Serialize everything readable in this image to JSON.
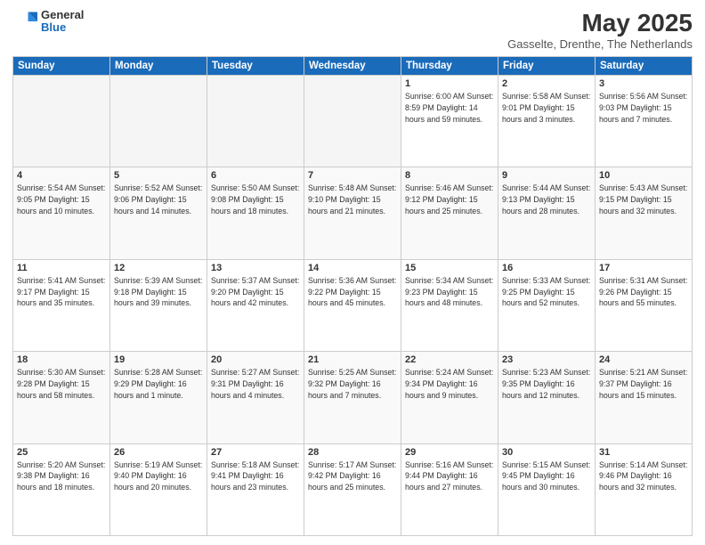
{
  "header": {
    "logo_general": "General",
    "logo_blue": "Blue",
    "month_title": "May 2025",
    "location": "Gasselte, Drenthe, The Netherlands"
  },
  "weekdays": [
    "Sunday",
    "Monday",
    "Tuesday",
    "Wednesday",
    "Thursday",
    "Friday",
    "Saturday"
  ],
  "weeks": [
    {
      "row_class": "row-odd",
      "days": [
        {
          "date": "",
          "info": "",
          "empty": true
        },
        {
          "date": "",
          "info": "",
          "empty": true
        },
        {
          "date": "",
          "info": "",
          "empty": true
        },
        {
          "date": "",
          "info": "",
          "empty": true
        },
        {
          "date": "1",
          "info": "Sunrise: 6:00 AM\nSunset: 8:59 PM\nDaylight: 14 hours\nand 59 minutes.",
          "empty": false
        },
        {
          "date": "2",
          "info": "Sunrise: 5:58 AM\nSunset: 9:01 PM\nDaylight: 15 hours\nand 3 minutes.",
          "empty": false
        },
        {
          "date": "3",
          "info": "Sunrise: 5:56 AM\nSunset: 9:03 PM\nDaylight: 15 hours\nand 7 minutes.",
          "empty": false
        }
      ]
    },
    {
      "row_class": "row-even",
      "days": [
        {
          "date": "4",
          "info": "Sunrise: 5:54 AM\nSunset: 9:05 PM\nDaylight: 15 hours\nand 10 minutes.",
          "empty": false
        },
        {
          "date": "5",
          "info": "Sunrise: 5:52 AM\nSunset: 9:06 PM\nDaylight: 15 hours\nand 14 minutes.",
          "empty": false
        },
        {
          "date": "6",
          "info": "Sunrise: 5:50 AM\nSunset: 9:08 PM\nDaylight: 15 hours\nand 18 minutes.",
          "empty": false
        },
        {
          "date": "7",
          "info": "Sunrise: 5:48 AM\nSunset: 9:10 PM\nDaylight: 15 hours\nand 21 minutes.",
          "empty": false
        },
        {
          "date": "8",
          "info": "Sunrise: 5:46 AM\nSunset: 9:12 PM\nDaylight: 15 hours\nand 25 minutes.",
          "empty": false
        },
        {
          "date": "9",
          "info": "Sunrise: 5:44 AM\nSunset: 9:13 PM\nDaylight: 15 hours\nand 28 minutes.",
          "empty": false
        },
        {
          "date": "10",
          "info": "Sunrise: 5:43 AM\nSunset: 9:15 PM\nDaylight: 15 hours\nand 32 minutes.",
          "empty": false
        }
      ]
    },
    {
      "row_class": "row-odd",
      "days": [
        {
          "date": "11",
          "info": "Sunrise: 5:41 AM\nSunset: 9:17 PM\nDaylight: 15 hours\nand 35 minutes.",
          "empty": false
        },
        {
          "date": "12",
          "info": "Sunrise: 5:39 AM\nSunset: 9:18 PM\nDaylight: 15 hours\nand 39 minutes.",
          "empty": false
        },
        {
          "date": "13",
          "info": "Sunrise: 5:37 AM\nSunset: 9:20 PM\nDaylight: 15 hours\nand 42 minutes.",
          "empty": false
        },
        {
          "date": "14",
          "info": "Sunrise: 5:36 AM\nSunset: 9:22 PM\nDaylight: 15 hours\nand 45 minutes.",
          "empty": false
        },
        {
          "date": "15",
          "info": "Sunrise: 5:34 AM\nSunset: 9:23 PM\nDaylight: 15 hours\nand 48 minutes.",
          "empty": false
        },
        {
          "date": "16",
          "info": "Sunrise: 5:33 AM\nSunset: 9:25 PM\nDaylight: 15 hours\nand 52 minutes.",
          "empty": false
        },
        {
          "date": "17",
          "info": "Sunrise: 5:31 AM\nSunset: 9:26 PM\nDaylight: 15 hours\nand 55 minutes.",
          "empty": false
        }
      ]
    },
    {
      "row_class": "row-even",
      "days": [
        {
          "date": "18",
          "info": "Sunrise: 5:30 AM\nSunset: 9:28 PM\nDaylight: 15 hours\nand 58 minutes.",
          "empty": false
        },
        {
          "date": "19",
          "info": "Sunrise: 5:28 AM\nSunset: 9:29 PM\nDaylight: 16 hours\nand 1 minute.",
          "empty": false
        },
        {
          "date": "20",
          "info": "Sunrise: 5:27 AM\nSunset: 9:31 PM\nDaylight: 16 hours\nand 4 minutes.",
          "empty": false
        },
        {
          "date": "21",
          "info": "Sunrise: 5:25 AM\nSunset: 9:32 PM\nDaylight: 16 hours\nand 7 minutes.",
          "empty": false
        },
        {
          "date": "22",
          "info": "Sunrise: 5:24 AM\nSunset: 9:34 PM\nDaylight: 16 hours\nand 9 minutes.",
          "empty": false
        },
        {
          "date": "23",
          "info": "Sunrise: 5:23 AM\nSunset: 9:35 PM\nDaylight: 16 hours\nand 12 minutes.",
          "empty": false
        },
        {
          "date": "24",
          "info": "Sunrise: 5:21 AM\nSunset: 9:37 PM\nDaylight: 16 hours\nand 15 minutes.",
          "empty": false
        }
      ]
    },
    {
      "row_class": "row-odd",
      "days": [
        {
          "date": "25",
          "info": "Sunrise: 5:20 AM\nSunset: 9:38 PM\nDaylight: 16 hours\nand 18 minutes.",
          "empty": false
        },
        {
          "date": "26",
          "info": "Sunrise: 5:19 AM\nSunset: 9:40 PM\nDaylight: 16 hours\nand 20 minutes.",
          "empty": false
        },
        {
          "date": "27",
          "info": "Sunrise: 5:18 AM\nSunset: 9:41 PM\nDaylight: 16 hours\nand 23 minutes.",
          "empty": false
        },
        {
          "date": "28",
          "info": "Sunrise: 5:17 AM\nSunset: 9:42 PM\nDaylight: 16 hours\nand 25 minutes.",
          "empty": false
        },
        {
          "date": "29",
          "info": "Sunrise: 5:16 AM\nSunset: 9:44 PM\nDaylight: 16 hours\nand 27 minutes.",
          "empty": false
        },
        {
          "date": "30",
          "info": "Sunrise: 5:15 AM\nSunset: 9:45 PM\nDaylight: 16 hours\nand 30 minutes.",
          "empty": false
        },
        {
          "date": "31",
          "info": "Sunrise: 5:14 AM\nSunset: 9:46 PM\nDaylight: 16 hours\nand 32 minutes.",
          "empty": false
        }
      ]
    }
  ]
}
